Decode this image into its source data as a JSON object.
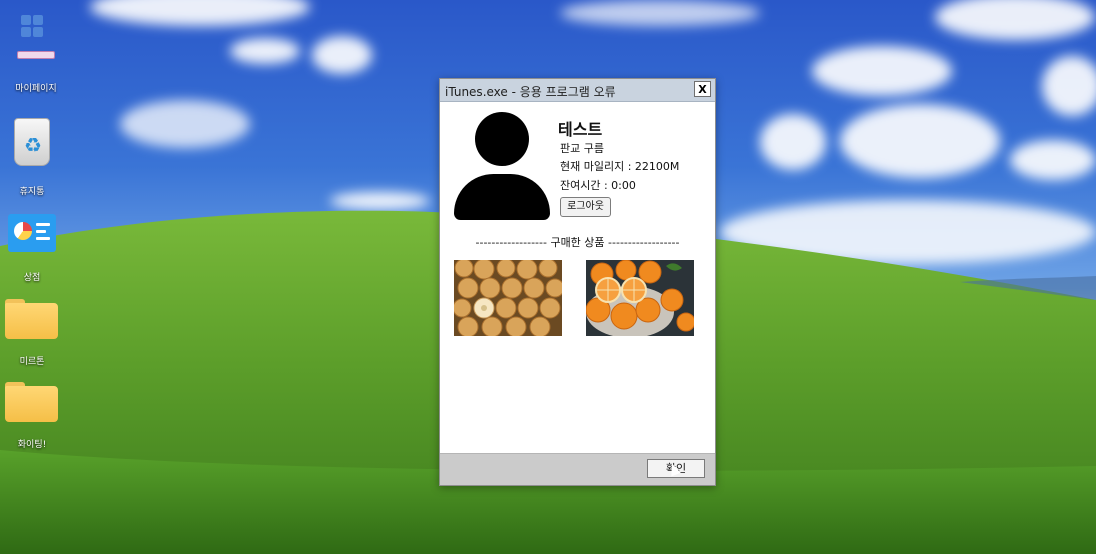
{
  "desktop": {
    "icons": [
      {
        "label": "마이페이지",
        "icon": "windows-logo-icon"
      },
      {
        "label": "휴지통",
        "icon": "recycle-bin-icon"
      },
      {
        "label": "상점",
        "icon": "store-icon"
      },
      {
        "label": "미르톤",
        "icon": "folder-icon"
      },
      {
        "label": "화이팅!",
        "icon": "folder-icon"
      }
    ]
  },
  "window": {
    "title": "iTunes.exe - 응용 프로그램 오류",
    "close_label": "X",
    "user": {
      "name": "테스트",
      "rank": "판교 구름",
      "mileage": "현재 마일리지 : 22100M",
      "remaining_time": "잔여시간 : 0:00",
      "logout_label": "로그아웃"
    },
    "section_divider": "------------------ 구매한 상품 ------------------",
    "products": [
      {
        "icon": "pears-image"
      },
      {
        "icon": "tangerines-image"
      }
    ],
    "ok_label": "확인"
  },
  "colors": {
    "sky": "#3a74d6",
    "grass": "#5c9e2a",
    "titlebar": "#c9d3df",
    "footer": "#cbcbcb",
    "folder": "#f5bf47"
  }
}
